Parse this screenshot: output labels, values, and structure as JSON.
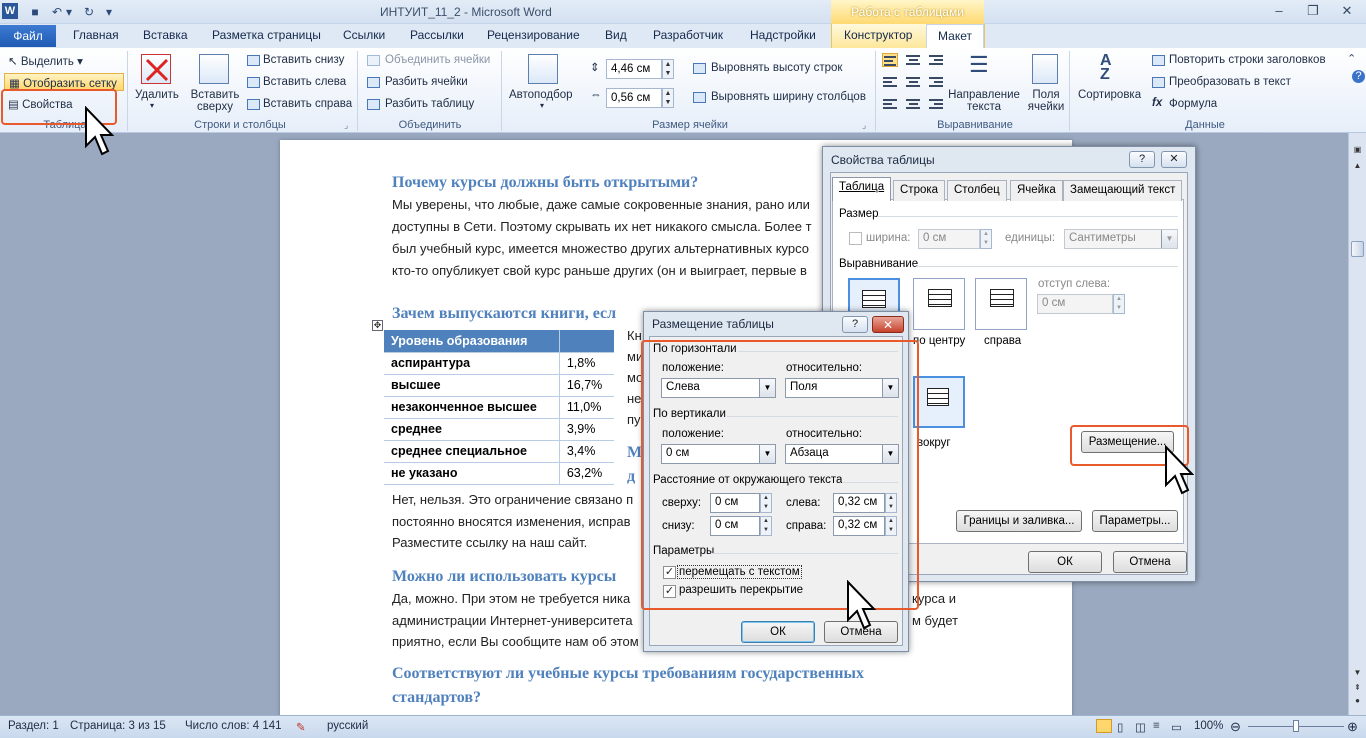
{
  "window": {
    "title": "ИНТУИТ_11_2 - Microsoft Word",
    "context_header": "Работа с таблицами"
  },
  "tabs": [
    "Файл",
    "Главная",
    "Вставка",
    "Разметка страницы",
    "Ссылки",
    "Рассылки",
    "Рецензирование",
    "Вид",
    "Разработчик",
    "Надстройки",
    "Конструктор",
    "Макет"
  ],
  "ribbon": {
    "table_group": {
      "select": "Выделить",
      "gridlines": "Отобразить сетку",
      "properties": "Свойства",
      "label": "Таблица"
    },
    "rows_cols": {
      "delete": "Удалить",
      "insert_above": "Вставить сверху",
      "insert_below": "Вставить снизу",
      "insert_left": "Вставить слева",
      "insert_right": "Вставить справа",
      "label": "Строки и столбцы"
    },
    "merge": {
      "merge_cells": "Объединить ячейки",
      "split_cells": "Разбить ячейки",
      "split_table": "Разбить таблицу",
      "label": "Объединить"
    },
    "cell_size": {
      "autofit": "Автоподбор",
      "height": "4,46 см",
      "width": "0,56 см",
      "dist_rows": "Выровнять высоту строк",
      "dist_cols": "Выровнять ширину столбцов",
      "label": "Размер ячейки"
    },
    "alignment": {
      "direction": "Направление текста",
      "margins": "Поля ячейки",
      "label": "Выравнивание"
    },
    "data": {
      "sort": "Сортировка",
      "repeat": "Повторить строки заголовков",
      "convert": "Преобразовать в текст",
      "formula": "Формула",
      "label": "Данные"
    }
  },
  "doc": {
    "h1": "Почему курсы должны быть открытыми?",
    "p1": [
      "Мы уверены, что любые, даже самые сокровенные знания, рано или",
      "доступны в Сети. Поэтому скрывать их нет никакого смысла. Более т",
      "был учебный курс, имеется множество других альтернативных курсо",
      "кто-то опубликует свой курс раньше других (он и выиграет, первые в"
    ],
    "h2": "Зачем выпускаются книги, есл",
    "table_header": [
      "Уровень образования",
      ""
    ],
    "table_rows": [
      [
        "аспирантура",
        "1,8%"
      ],
      [
        "высшее",
        "16,7%"
      ],
      [
        "незаконченное высшее",
        "11,0%"
      ],
      [
        "среднее",
        "3,9%"
      ],
      [
        "среднее специальное",
        "3,4%"
      ],
      [
        "не указано",
        "63,2%"
      ]
    ],
    "side_text": [
      "Кн",
      "ми",
      "мо",
      "не",
      "пу"
    ],
    "side_h": [
      "М",
      "д"
    ],
    "p2": [
      "Нет, нельзя. Это ограничение связано п",
      "постоянно вносятся изменения, исправ",
      "Разместите ссылку на наш сайт."
    ],
    "h3": "Можно ли использовать курсы",
    "p3": [
      "Да, можно. При этом не требуется ника",
      "администрации Интернет-университета",
      "приятно, если Вы сообщите нам об этом"
    ],
    "p3_right": [
      "курса и",
      "м будет"
    ],
    "h4": [
      "Соответствуют ли учебные курсы требованиям государственных",
      "стандартов?"
    ]
  },
  "props_dialog": {
    "title": "Свойства таблицы",
    "tabs": [
      "Таблица",
      "Строка",
      "Столбец",
      "Ячейка",
      "Замещающий текст"
    ],
    "size_label": "Размер",
    "width_label": "ширина:",
    "width_value": "0 см",
    "units_label": "единицы:",
    "units_value": "Сантиметры",
    "align_label": "Выравнивание",
    "indent_label": "отступ слева:",
    "indent_value": "0 см",
    "center_label": "по центру",
    "right_label": "справа",
    "around_label": "вокруг",
    "placement_btn": "Размещение...",
    "borders_btn": "Границы и заливка...",
    "options_btn": "Параметры...",
    "ok": "ОК",
    "cancel": "Отмена"
  },
  "place_dialog": {
    "title": "Размещение таблицы",
    "horizontal": "По горизонтали",
    "position": "положение:",
    "relative": "относительно:",
    "h_pos": "Слева",
    "h_rel": "Поля",
    "vertical": "По вертикали",
    "v_pos": "0 см",
    "v_rel": "Абзаца",
    "distance": "Расстояние от окружающего текста",
    "top": "сверху:",
    "top_val": "0 см",
    "left": "слева:",
    "left_val": "0,32 см",
    "bottom": "снизу:",
    "bottom_val": "0 см",
    "right": "справа:",
    "right_val": "0,32 см",
    "params": "Параметры",
    "move_with_text": "перемещать с текстом",
    "allow_overlap": "разрешить перекрытие",
    "ok": "ОК",
    "cancel": "Отмена"
  },
  "statusbar": {
    "section": "Раздел: 1",
    "page": "Страница: 3 из 15",
    "words": "Число слов: 4 141",
    "lang": "русский",
    "zoom": "100%"
  }
}
